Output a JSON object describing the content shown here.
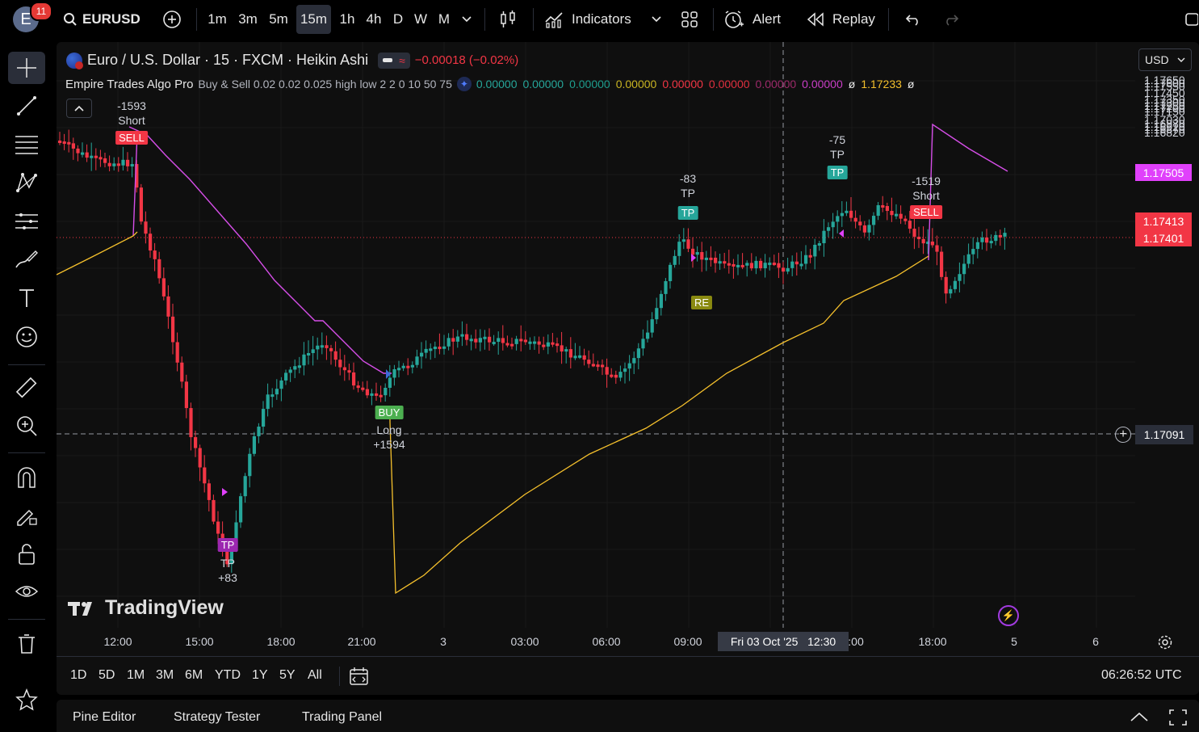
{
  "topbar": {
    "avatar_letter": "E",
    "notif_count": "11",
    "symbol": "EURUSD",
    "intervals": [
      "1m",
      "3m",
      "5m",
      "15m",
      "1h",
      "4h",
      "D",
      "W",
      "M"
    ],
    "active_interval": "15m",
    "indicators_label": "Indicators",
    "alert_label": "Alert",
    "replay_label": "Replay"
  },
  "legend": {
    "title": "Euro / U.S. Dollar · 15 · FXCM · Heikin Ashi",
    "change": "−0.00018 (−0.02%)",
    "indicator_name": "Empire Trades Algo Pro",
    "indicator_params": "Buy & Sell 0.02 0.02 0.025 high low 2 2 0 10 50 75",
    "values": [
      {
        "v": "0.00000",
        "c": "#26a69a"
      },
      {
        "v": "0.00000",
        "c": "#26a69a"
      },
      {
        "v": "0.00000",
        "c": "#1e9e8e"
      },
      {
        "v": "0.00000",
        "c": "#c9b422"
      },
      {
        "v": "0.00000",
        "c": "#f23645"
      },
      {
        "v": "0.00000",
        "c": "#e0303f"
      },
      {
        "v": "0.00000",
        "c": "#9c2a6a"
      },
      {
        "v": "0.00000",
        "c": "#c93ec6"
      },
      {
        "v": "ø",
        "c": "#e6e6e6"
      },
      {
        "v": "1.17233",
        "c": "#f5c02c"
      },
      {
        "v": "ø",
        "c": "#e6e6e6"
      }
    ]
  },
  "currency": "USD",
  "price_axis": {
    "labels": [
      "1.17650",
      "1.17600",
      "1.17550",
      "1.17450",
      "1.17350",
      "1.17300",
      "1.17250",
      "1.17200",
      "1.17150",
      "1.17030",
      "1.16970",
      "1.16920",
      "1.16870",
      "1.16820"
    ],
    "tags": [
      {
        "v": "1.17505",
        "c": "#e040fb"
      },
      {
        "v": "1.17413",
        "c": "#f23645"
      },
      {
        "v": "1.17401",
        "c": "#f23645"
      }
    ],
    "crosshair_price": "1.17091"
  },
  "time_axis": {
    "labels": [
      "12:00",
      "15:00",
      "18:00",
      "21:00",
      "3",
      "03:00",
      "06:00",
      "09:00",
      ":00",
      "18:00",
      "5",
      "6"
    ],
    "crosshair_time": "Fri 03 Oct '25   12:30"
  },
  "signals": [
    {
      "kind": "SELL",
      "lines": [
        "-1593",
        "Short"
      ]
    },
    {
      "kind": "TP",
      "lines": [
        "TP",
        "+83"
      ]
    },
    {
      "kind": "BUY",
      "lines": [
        "Long",
        "+1594"
      ]
    },
    {
      "kind": "TP",
      "lines": [
        "-83",
        "TP"
      ]
    },
    {
      "kind": "RE",
      "lines": []
    },
    {
      "kind": "TP",
      "lines": [
        "-75",
        "TP"
      ]
    },
    {
      "kind": "SELL",
      "lines": [
        "-1519",
        "Short"
      ]
    }
  ],
  "watermark": "TradingView",
  "ranges": [
    "1D",
    "5D",
    "1M",
    "3M",
    "6M",
    "YTD",
    "1Y",
    "5Y",
    "All"
  ],
  "clock": "06:26:52 UTC",
  "panel_tabs": [
    "Pine Editor",
    "Strategy Tester",
    "Trading Panel"
  ],
  "colors": {
    "up": "#26a69a",
    "down": "#f23645",
    "pink_line": "#d64ee8",
    "yellow_line": "#f5c02c"
  }
}
